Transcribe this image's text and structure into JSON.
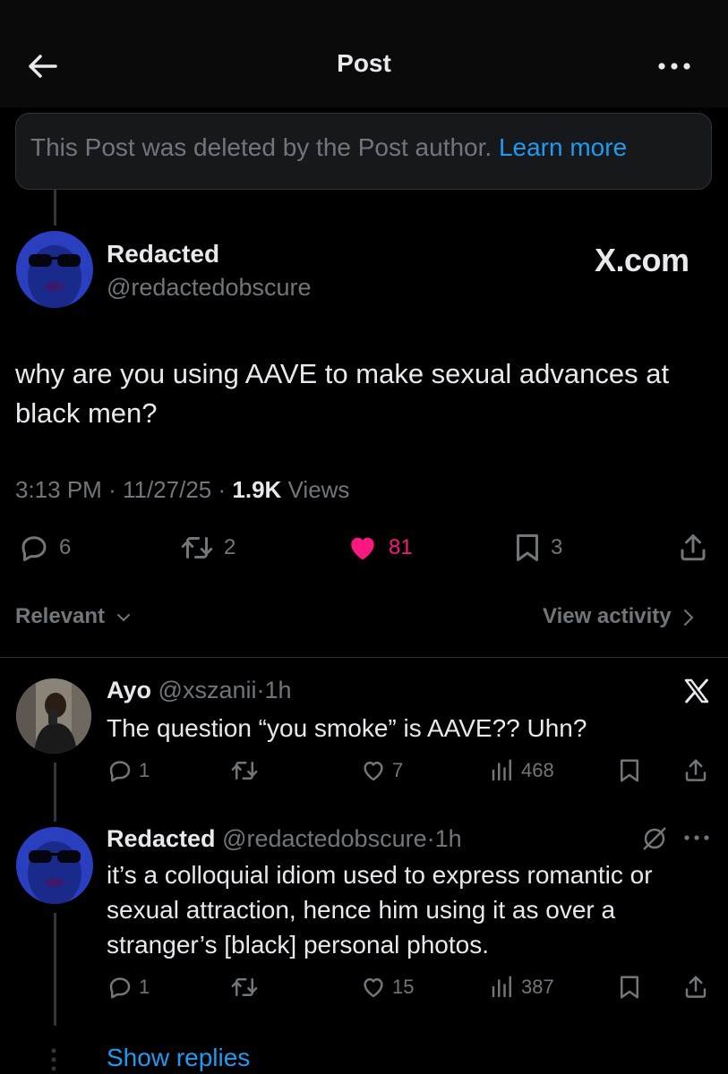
{
  "header": {
    "title": "Post"
  },
  "deleted_notice": {
    "text": "This Post was deleted by the Post author.",
    "link": "Learn more"
  },
  "main_post": {
    "author": {
      "name": "Redacted",
      "handle": "@redactedobscure"
    },
    "watermark": "X.com",
    "text": "why are you using AAVE to make sexual advances at black men?",
    "time": "3:13 PM",
    "date": "11/27/25",
    "views_count": "1.9K",
    "views_label": "Views",
    "separator": "·",
    "stats": {
      "replies": "6",
      "reposts": "2",
      "likes": "81",
      "bookmarks": "3"
    },
    "liked": true,
    "like_color": "#f91880"
  },
  "replies_bar": {
    "sort": "Relevant",
    "activity": "View activity"
  },
  "replies": [
    {
      "name": "Ayo",
      "handle": "@xszanii",
      "time": "1h",
      "separator": "·",
      "text": "The question “you smoke” is AAVE?? Uhn?",
      "stats": {
        "replies": "1",
        "likes": "7",
        "views": "468"
      },
      "badge_icon": "x-logo-icon"
    },
    {
      "name": "Redacted",
      "handle": "@redactedobscure",
      "time": "1h",
      "separator": "·",
      "text": "it’s a colloquial idiom used to express romantic or sexual attraction, hence him using it as over a stranger’s [black] personal photos.",
      "stats": {
        "replies": "1",
        "likes": "15",
        "views": "387"
      },
      "badge_icon": "grok-icon"
    }
  ],
  "show_replies": "Show replies",
  "colors": {
    "accent": "#1d9bf0",
    "muted": "#71767b",
    "text": "#e7e9ea",
    "background": "#000000",
    "like": "#f91880"
  }
}
